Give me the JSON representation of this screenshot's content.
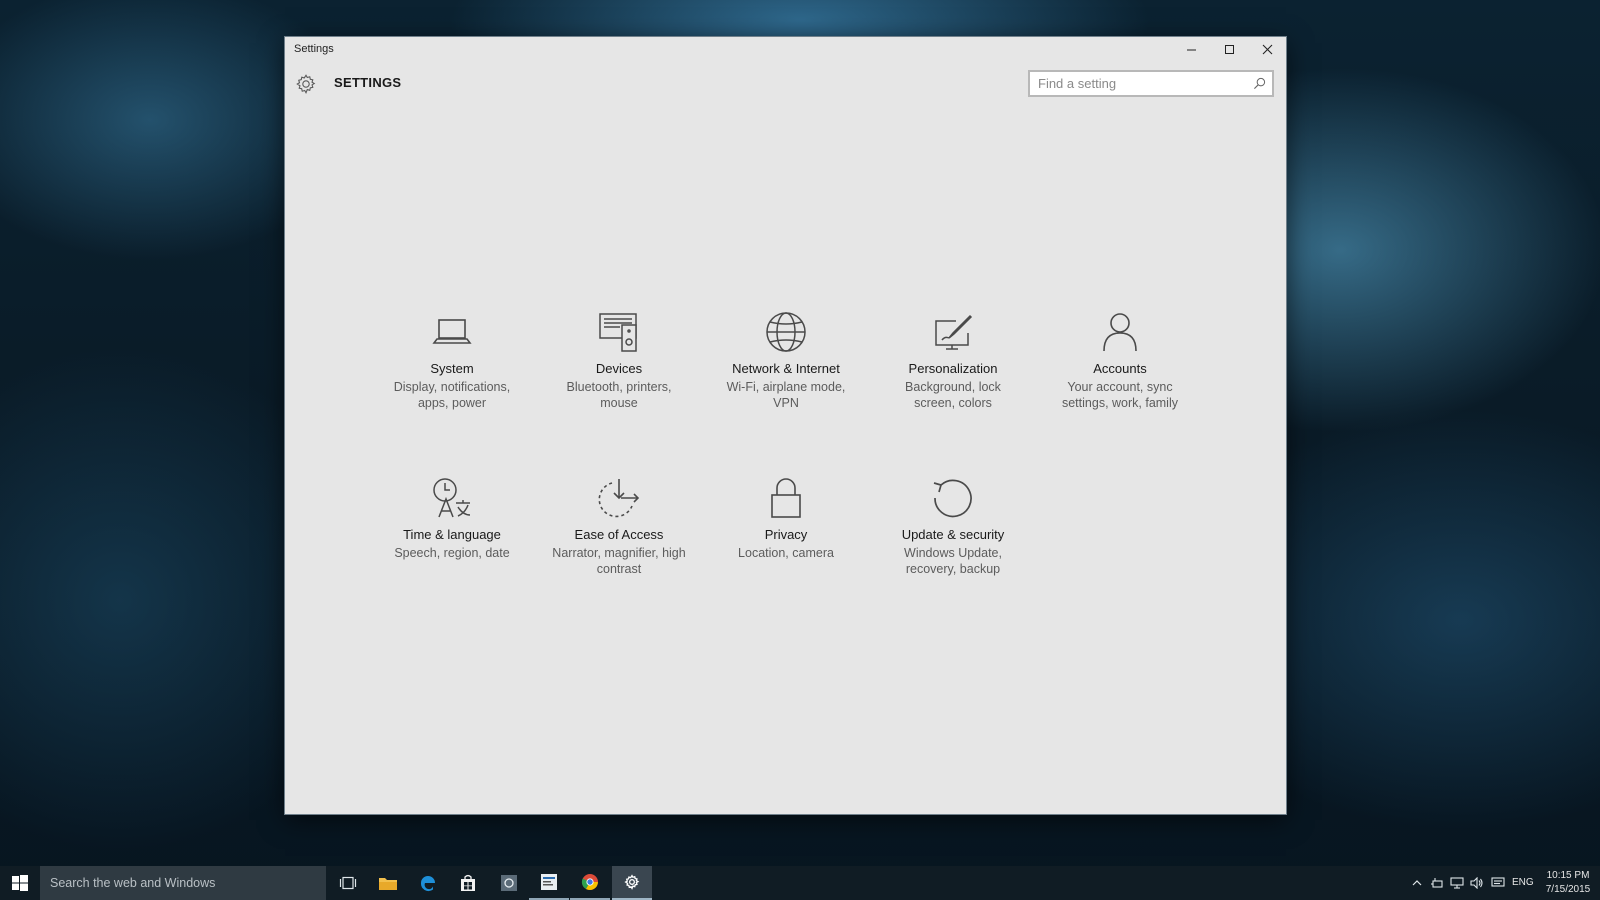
{
  "window": {
    "title": "Settings",
    "header_title": "SETTINGS",
    "search_placeholder": "Find a setting"
  },
  "tiles": [
    {
      "name": "System",
      "desc": "Display, notifications, apps, power",
      "icon": "laptop-icon"
    },
    {
      "name": "Devices",
      "desc": "Bluetooth, printers, mouse",
      "icon": "devices-icon"
    },
    {
      "name": "Network & Internet",
      "desc": "Wi-Fi, airplane mode, VPN",
      "icon": "globe-icon"
    },
    {
      "name": "Personalization",
      "desc": "Background, lock screen, colors",
      "icon": "personalization-icon"
    },
    {
      "name": "Accounts",
      "desc": "Your account, sync settings, work, family",
      "icon": "person-icon"
    },
    {
      "name": "Time & language",
      "desc": "Speech, region, date",
      "icon": "time-language-icon"
    },
    {
      "name": "Ease of Access",
      "desc": "Narrator, magnifier, high contrast",
      "icon": "ease-of-access-icon"
    },
    {
      "name": "Privacy",
      "desc": "Location, camera",
      "icon": "lock-icon"
    },
    {
      "name": "Update & security",
      "desc": "Windows Update, recovery, backup",
      "icon": "update-icon"
    }
  ],
  "taskbar": {
    "search_text": "Search the web and Windows",
    "language": "ENG",
    "time": "10:15 PM",
    "date": "7/15/2015"
  }
}
